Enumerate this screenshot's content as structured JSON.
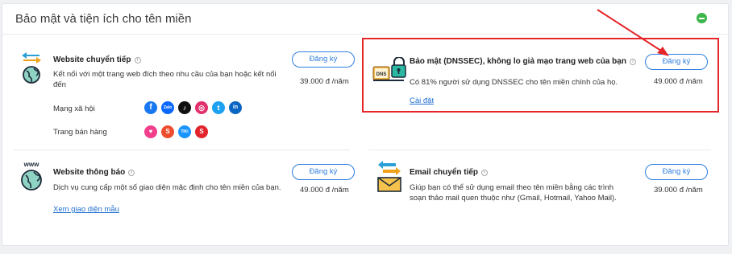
{
  "panel": {
    "title": "Bảo mật và tiện ích cho tên miền"
  },
  "services": {
    "website_forward": {
      "name": "Website chuyển tiếp",
      "desc": "Kết nối với một trang web đích theo nhu cầu của bạn hoặc kết nối đến",
      "button": "Đăng ký",
      "price": "39.000 đ /năm",
      "social_label": "Mạng xã hội",
      "shop_label": "Trang bán hàng",
      "social_icons": [
        "facebook-icon",
        "zalo-icon",
        "tiktok-icon",
        "instagram-icon",
        "twitter-icon",
        "linkedin-icon"
      ],
      "shop_icons": [
        "lazada-icon",
        "shopee-icon",
        "tiki-icon",
        "sendo-icon"
      ]
    },
    "dnssec": {
      "name": "Bảo mật (DNSSEC), không lo giả mạo trang web của bạn",
      "desc": "Có 81% người sử dụng DNSSEC cho tên miền chính của họ.",
      "link": "Cài đặt",
      "button": "Đăng ký",
      "price": "49.000 đ /năm",
      "icon_text": "DNS"
    },
    "website_notice": {
      "name": "Website thông báo",
      "desc": "Dịch vụ cung cấp một số giao diện mặc định cho tên miền của bạn.",
      "link": "Xem giao diện mẫu",
      "button": "Đăng ký",
      "price": "49.000 đ /năm",
      "icon_text": "www"
    },
    "email_forward": {
      "name": "Email chuyển tiếp",
      "desc": "Giúp bạn có thể sử dụng email theo tên miền bằng các trình soạn thảo mail quen thuộc như (Gmail, Hotmail, Yahoo Mail).",
      "button": "Đăng ký",
      "price": "39.000 đ /năm"
    }
  },
  "social_glyphs": {
    "facebook": "f",
    "zalo": "Zalo",
    "tiktok": "♪",
    "instagram": "◎",
    "twitter": "t",
    "linkedin": "in",
    "lazada": "♥",
    "shopee": "S",
    "tiki": "TiKi",
    "sendo": "S"
  },
  "colors": {
    "accent": "#2f7ee0",
    "highlight": "#e5252a",
    "collapse": "#3cb54a"
  }
}
